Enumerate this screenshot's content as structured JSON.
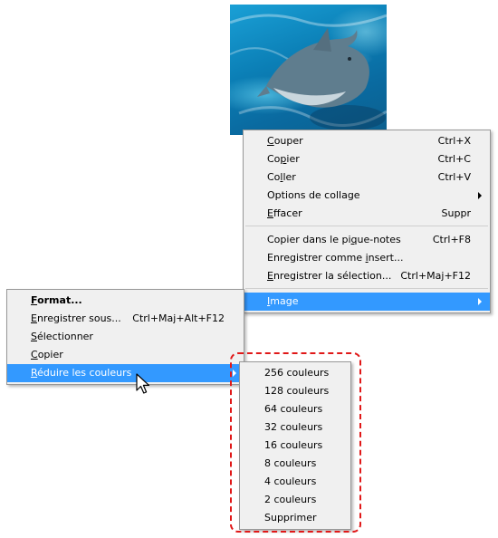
{
  "context_menu": {
    "items": [
      {
        "pre": "",
        "u": "C",
        "post": "ouper",
        "shortcut": "Ctrl+X"
      },
      {
        "pre": "Co",
        "u": "p",
        "post": "ier",
        "shortcut": "Ctrl+C"
      },
      {
        "pre": "Co",
        "u": "l",
        "post": "ler",
        "shortcut": "Ctrl+V"
      },
      {
        "pre": "Options de collage",
        "u": "",
        "post": "",
        "shortcut": ""
      },
      {
        "pre": "",
        "u": "E",
        "post": "ffacer",
        "shortcut": "Suppr"
      },
      {
        "pre": "Copier dans le pi",
        "u": "q",
        "post": "ue-notes",
        "shortcut": "Ctrl+F8"
      },
      {
        "pre": "Enregistrer comme ",
        "u": "i",
        "post": "nsert...",
        "shortcut": ""
      },
      {
        "pre": "",
        "u": "E",
        "post": "nregistrer la sélection...",
        "shortcut": "Ctrl+Maj+F12"
      },
      {
        "pre": "",
        "u": "I",
        "post": "mage",
        "shortcut": ""
      }
    ]
  },
  "image_menu": {
    "items": [
      {
        "pre": "",
        "u": "F",
        "post": "ormat...",
        "shortcut": ""
      },
      {
        "pre": "",
        "u": "E",
        "post": "nregistrer sous...",
        "shortcut": "Ctrl+Maj+Alt+F12"
      },
      {
        "pre": "",
        "u": "S",
        "post": "électionner",
        "shortcut": ""
      },
      {
        "pre": "",
        "u": "C",
        "post": "opier",
        "shortcut": ""
      },
      {
        "pre": "",
        "u": "R",
        "post": "éduire les couleurs",
        "shortcut": ""
      }
    ]
  },
  "reduce_colors_menu": {
    "items": [
      "256 couleurs",
      "128 couleurs",
      "64 couleurs",
      "32 couleurs",
      "16 couleurs",
      "8 couleurs",
      "4 couleurs",
      "2 couleurs",
      "Supprimer"
    ]
  },
  "icons": {
    "pointer": "mouse-pointer-icon",
    "submenu": "submenu-arrow-icon"
  },
  "colors": {
    "highlight": "#3399ff",
    "callout": "#e01818",
    "menu_bg": "#f0f0f0"
  }
}
